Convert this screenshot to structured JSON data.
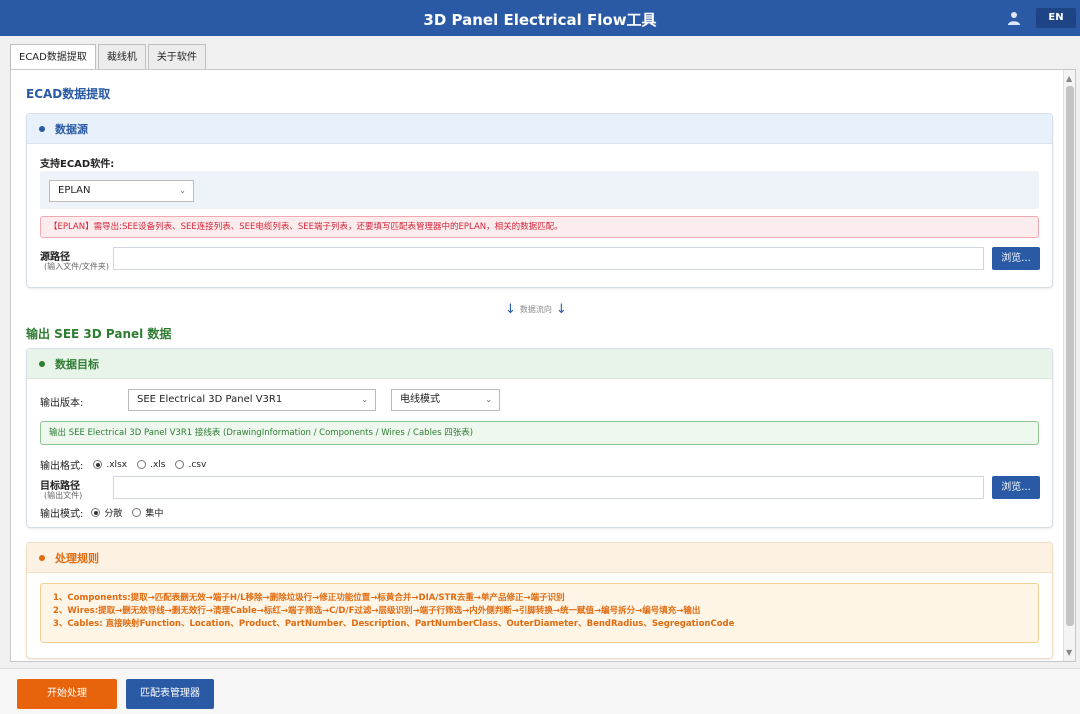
{
  "app": {
    "title": "3D Panel Electrical Flow工具",
    "lang_button": "EN",
    "user_icon": "user-icon"
  },
  "tabs": [
    {
      "label": "ECAD数据提取",
      "active": true
    },
    {
      "label": "裁线机",
      "active": false
    },
    {
      "label": "关于软件",
      "active": false
    }
  ],
  "ecad": {
    "title": "ECAD数据提取",
    "source_card": {
      "header": "数据源",
      "software_label": "支持ECAD软件:",
      "software_value": "EPLAN",
      "alert": "【EPLAN】需导出:SEE设备列表、SEE连接列表、SEE电缆列表、SEE端子列表，还要填写匹配表管理器中的EPLAN，相关的数据匹配。",
      "path_label": "源路径",
      "path_sublabel": "(输入文件/文件夹)",
      "path_value": "",
      "browse_label": "浏览..."
    }
  },
  "flow": {
    "label": "数据流向",
    "arrow": "↓"
  },
  "output": {
    "title": "输出 SEE 3D Panel 数据",
    "target_card": {
      "header": "数据目标",
      "version_label": "输出版本:",
      "version_value": "SEE Electrical 3D Panel V3R1",
      "mode_value": "电线模式",
      "alert": "输出 SEE Electrical 3D Panel V3R1 接线表 (DrawingInformation / Components / Wires / Cables 四张表)",
      "format_label": "输出格式:",
      "format_options": [
        ".xlsx",
        ".xls",
        ".csv"
      ],
      "format_selected": ".xlsx",
      "path_label": "目标路径",
      "path_sublabel": "(输出文件)",
      "path_value": "",
      "browse_label": "浏览...",
      "output_mode_label": "输出模式:",
      "output_mode_options": [
        "分散",
        "集中"
      ],
      "output_mode_selected": "分散"
    },
    "rules_card": {
      "header": "处理规则",
      "rules": [
        "1、Components:提取→匹配表删无效→端子H/L移除→删除垃圾行→修正功能位置→标黄合并→DIA/STR去重→单产品修正→端子识别",
        "2、Wires:提取→删无效导线→删无效行→清理Cable→标红→端子筛选→C/D/F过滤→层级识别→端子行筛选→内外侧判断→引脚转换→统一赋值→编号拆分→编号填充→输出",
        "3、Cables: 直接映射Function、Location、Product、PartNumber、Description、PartNumberClass、OuterDiameter、BendRadius、SegregationCode"
      ]
    }
  },
  "footer": {
    "start_label": "开始处理",
    "match_manager_label": "匹配表管理器"
  },
  "colors": {
    "primary": "#2a5aa6",
    "accent": "#e8640c",
    "success": "#2e7d32",
    "danger": "#d3263a"
  }
}
